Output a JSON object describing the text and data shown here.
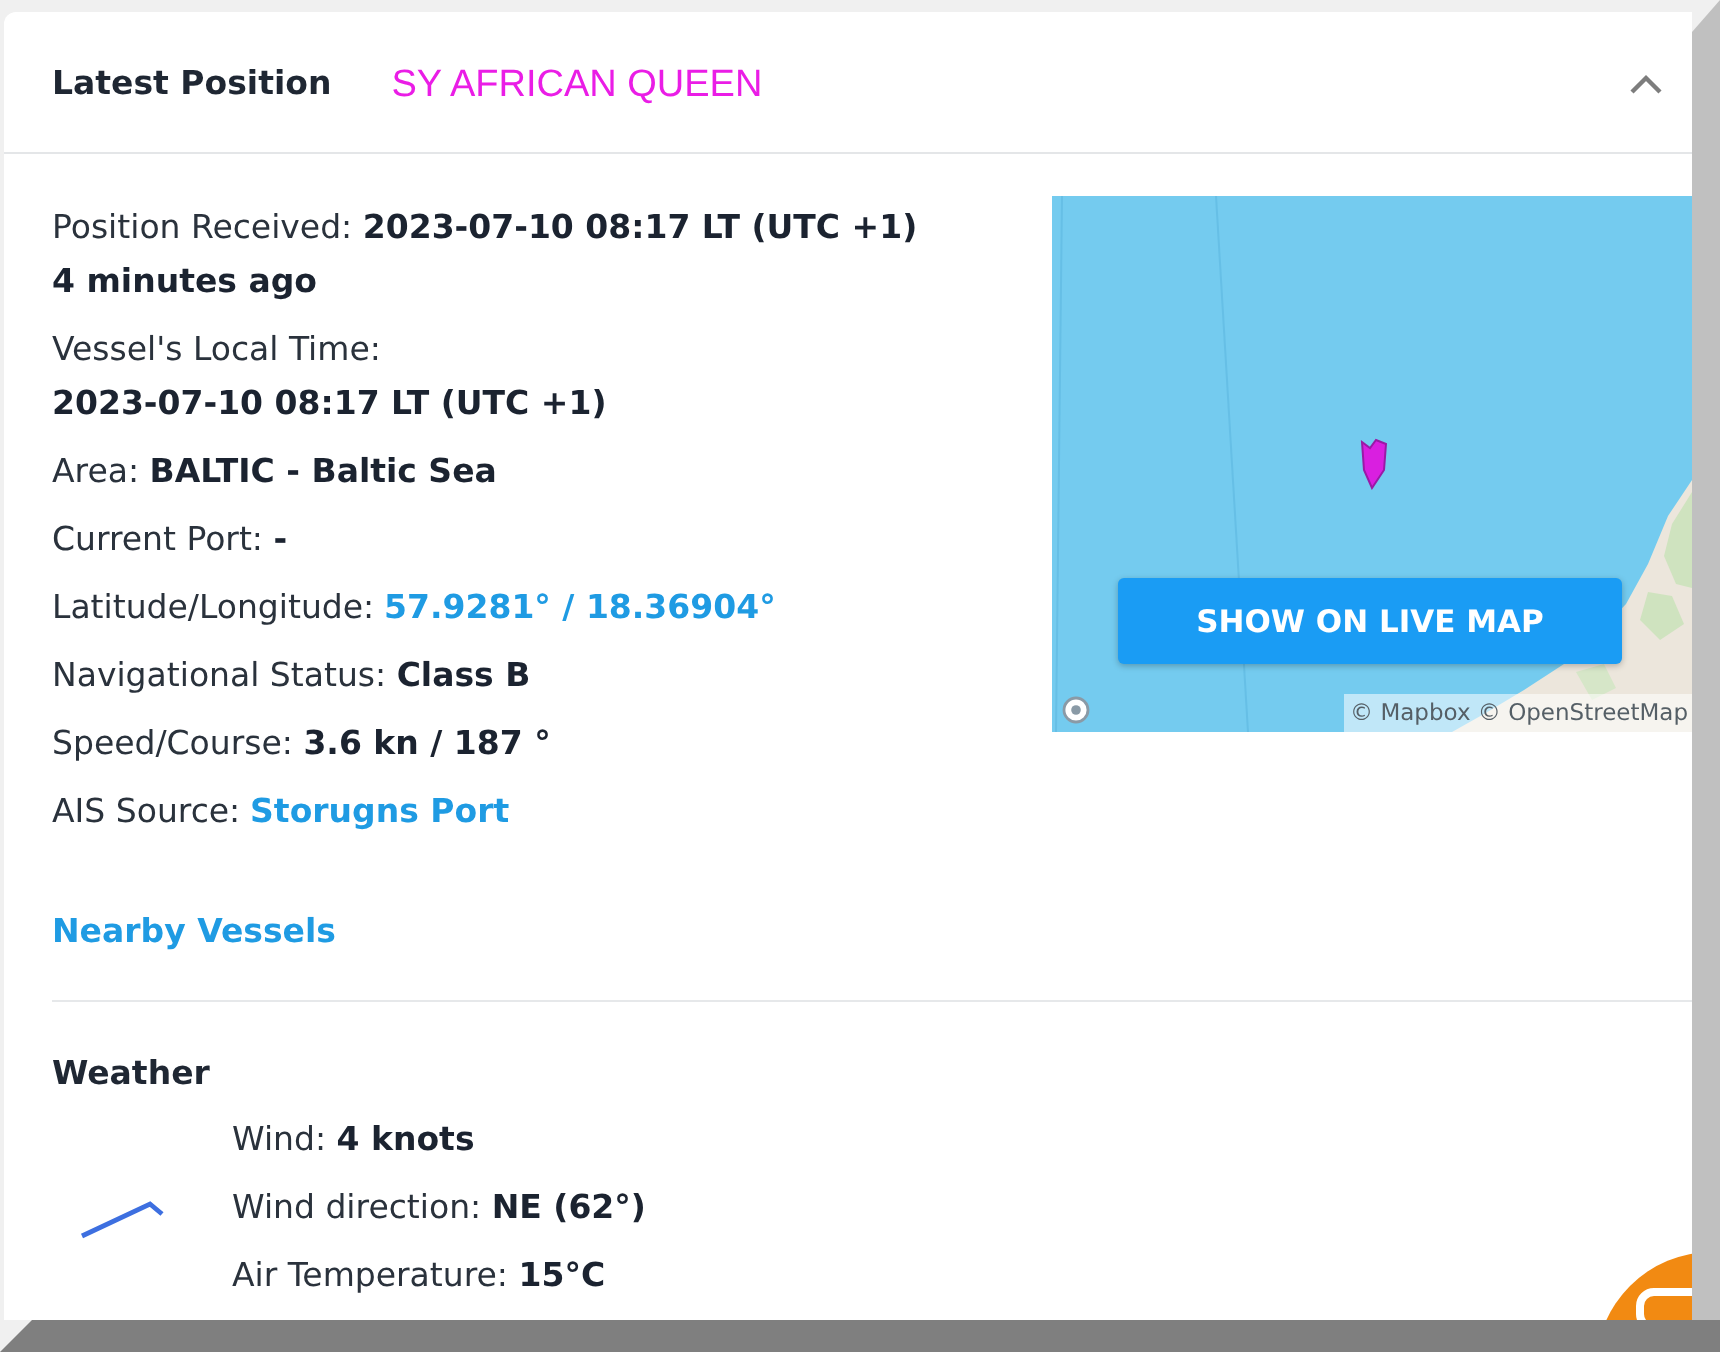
{
  "panel": {
    "title": "Latest Position",
    "vessel_name": "SY AFRICAN QUEEN",
    "expanded": true
  },
  "details": [
    {
      "kind": "text",
      "text": "Position Received: **2023-07-10 08:17 LT (UTC +1)**",
      "note": "4 minutes ago"
    },
    {
      "kind": "stacked",
      "text": "Vessel's Local Time: **2023-07-10 08:17 LT (UTC +1)**"
    },
    {
      "kind": "text",
      "text": "Area: **BALTIC - Baltic Sea**"
    },
    {
      "kind": "text",
      "text": "Current Port: **-**"
    },
    {
      "kind": "link",
      "label": "Latitude/Longitude:",
      "link": "57.9281° / 18.36904°"
    },
    {
      "kind": "text",
      "text": "Navigational Status: **Class B**"
    },
    {
      "kind": "text",
      "text": "Speed/Course: **3.6 kn / 187 °**"
    },
    {
      "kind": "link",
      "label": "AIS Source:",
      "link": "Storugns Port"
    }
  ],
  "map": {
    "button": "SHOW ON LIVE MAP",
    "attribution": "© Mapbox © OpenStreetMap"
  },
  "nearby_link": "Nearby Vessels",
  "weather": {
    "title": "Weather",
    "rows": [
      {
        "label": "Wind:",
        "value": "4 knots"
      },
      {
        "label": "Wind direction:",
        "value": "NE (62°)"
      },
      {
        "label": "Air Temperature:",
        "value": "15°C"
      }
    ]
  }
}
